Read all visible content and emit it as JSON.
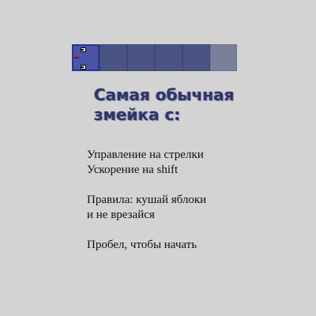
{
  "game": {
    "title": "Самая обычная\nзмейка с:",
    "controls_arrows": "Управление на стрелки",
    "controls_boost": "Ускорение на shift",
    "rules_line1": "Правила: кушай яблоки",
    "rules_line2": "и не врезайся",
    "start_hint": "Пробел, чтобы начать"
  },
  "snake": {
    "segments": [
      "head",
      "body",
      "body",
      "body",
      "body",
      "tail"
    ],
    "colors": {
      "head": "#4b55a6",
      "body": "#4a5484",
      "tail": "#7a7f9a",
      "tongue": "#8a0f0f"
    }
  }
}
